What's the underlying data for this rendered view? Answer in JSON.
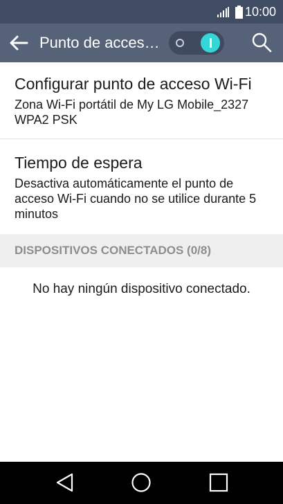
{
  "status_bar": {
    "time": "10:00",
    "icons": [
      "signal-icon",
      "battery-icon"
    ]
  },
  "toolbar": {
    "title": "Punto de acceso Wi-Fi",
    "back_icon": "arrow-left-icon",
    "switch_on": true,
    "search_icon": "search-icon"
  },
  "preferences": [
    {
      "title": "Configurar punto de acceso Wi-Fi",
      "summary": "Zona Wi-Fi portátil de My LG Mobile_2327 WPA2 PSK"
    },
    {
      "title": "Tiempo de espera",
      "summary": "Desactiva automáticamente el punto de acceso Wi-Fi cuando no se utilice durante 5 minutos"
    }
  ],
  "connected_devices": {
    "header": "DISPOSITIVOS CONECTADOS (0/8)",
    "empty_message": "No hay ningún dispositivo conectado."
  },
  "navigation_bar": {
    "icons": [
      "back-triangle-icon",
      "home-circle-icon",
      "recents-square-icon"
    ]
  },
  "colors": {
    "status_bar": "#3f4c63",
    "toolbar": "#556278",
    "switch_track": "#3f4a5f",
    "switch_knob": "#35d6d6",
    "section_header_bg": "#efefef",
    "section_header_text": "#8d8d8d"
  }
}
